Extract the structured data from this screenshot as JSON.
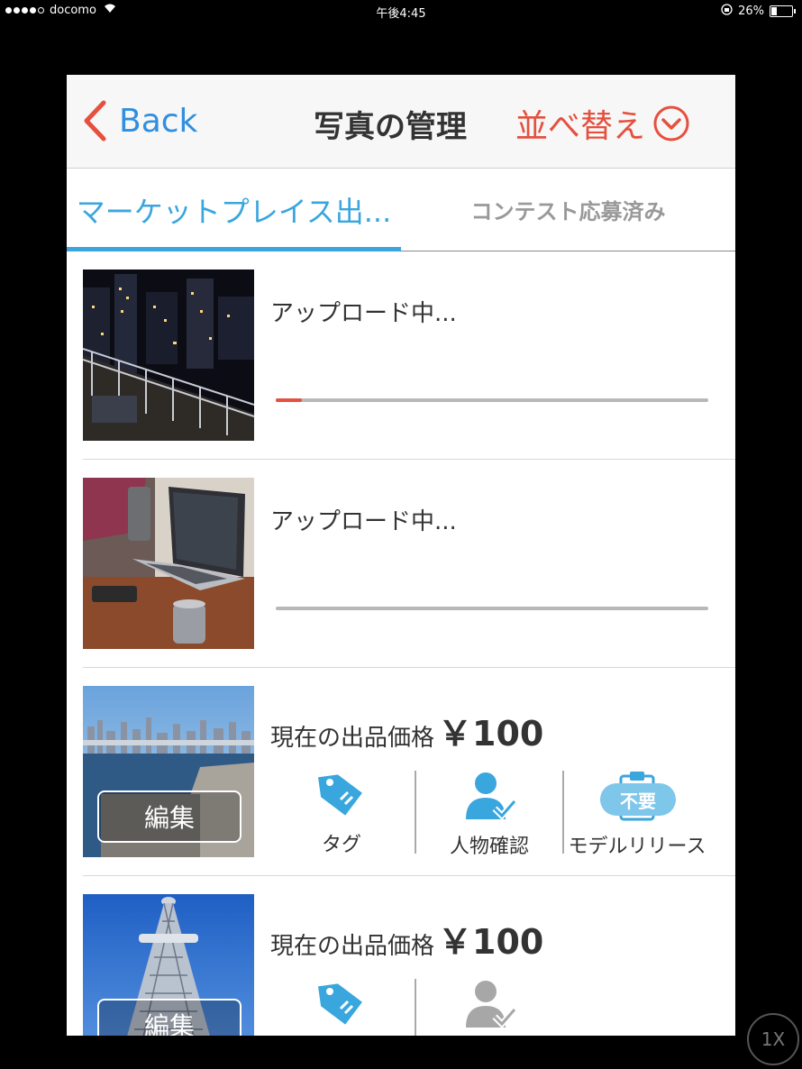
{
  "status_bar": {
    "carrier": "docomo",
    "time": "午後4:45",
    "battery": "26%",
    "battery_level": 0.26
  },
  "nav": {
    "back_label": "Back",
    "title": "写真の管理",
    "sort_label": "並べ替え"
  },
  "tabs": [
    {
      "label": "マーケットプレイス出..."
    },
    {
      "label": "コンテスト応募済み"
    }
  ],
  "items": [
    {
      "status": "アップロード中...",
      "progress": 0.06
    },
    {
      "status": "アップロード中...",
      "progress": 0.0
    },
    {
      "price_label": "現在の出品価格",
      "price": "￥100",
      "edit_label": "編集",
      "actions": [
        {
          "label": "タグ",
          "icon": "tag-icon"
        },
        {
          "label": "人物確認",
          "icon": "person-check-icon"
        },
        {
          "label": "モデルリリース",
          "icon": "clipboard-icon",
          "badge": "不要"
        }
      ]
    },
    {
      "price_label": "現在の出品価格",
      "price": "￥100",
      "edit_label": "編集"
    }
  ],
  "zoom_label": "1X",
  "colors": {
    "accent_blue": "#39a6de",
    "accent_red": "#e5503f",
    "link_blue": "#2f8fe0"
  }
}
